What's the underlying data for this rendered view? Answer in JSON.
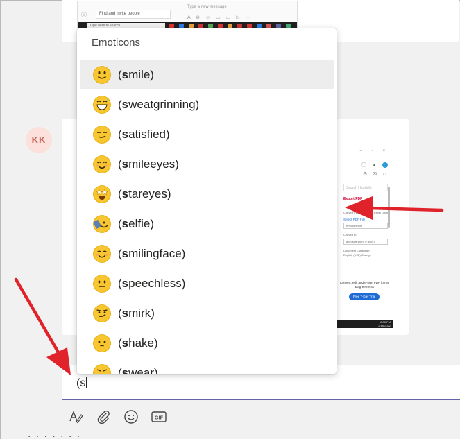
{
  "background": {
    "top_screenshot": {
      "find_people": "Find and invite people",
      "type_new_message": "Type a new message",
      "taskbar_search": "Type here to search"
    },
    "avatar_initials": "KK",
    "right_screenshot": {
      "search_placeholder": "Search Highlight",
      "export_pdf": "Export PDF",
      "convert_text": "Convert PDF to Word or Excel Online",
      "select_pdf_file": "Select PDF File",
      "file_name": "mmouddy.pdf",
      "convert_to": "Convert to",
      "convert_to_value": "Microsoft Word (*.docx)",
      "doc_language": "Document Language:",
      "language_value": "English (U.S.) Change",
      "promo_text": "Convert, edit and e-sign PDF forms & agreements",
      "promo_button": "Free 7-Day Trial",
      "clock_time": "8:38 PM",
      "clock_date": "2/16/2022"
    },
    "partial_text": "I"
  },
  "popup": {
    "title": "Emoticons",
    "items": [
      {
        "prefix": "(",
        "match": "s",
        "rest": "mile)",
        "icon": "smile-emoji-icon",
        "selected": true
      },
      {
        "prefix": "(",
        "match": "s",
        "rest": "weatgrinning)",
        "icon": "sweatgrinning-emoji-icon",
        "selected": false
      },
      {
        "prefix": "(",
        "match": "s",
        "rest": "atisfied)",
        "icon": "satisfied-emoji-icon",
        "selected": false
      },
      {
        "prefix": "(",
        "match": "s",
        "rest": "mileeyes)",
        "icon": "smileeyes-emoji-icon",
        "selected": false
      },
      {
        "prefix": "(",
        "match": "s",
        "rest": "tareyes)",
        "icon": "stareyes-emoji-icon",
        "selected": false
      },
      {
        "prefix": "(",
        "match": "s",
        "rest": "elfie)",
        "icon": "selfie-emoji-icon",
        "selected": false
      },
      {
        "prefix": "(",
        "match": "s",
        "rest": "milingface)",
        "icon": "smilingface-emoji-icon",
        "selected": false
      },
      {
        "prefix": "(",
        "match": "s",
        "rest": "peechless)",
        "icon": "speechless-emoji-icon",
        "selected": false
      },
      {
        "prefix": "(",
        "match": "s",
        "rest": "mirk)",
        "icon": "smirk-emoji-icon",
        "selected": false
      },
      {
        "prefix": "(",
        "match": "s",
        "rest": "hake)",
        "icon": "shake-emoji-icon",
        "selected": false
      },
      {
        "prefix": "(",
        "match": "s",
        "rest": "wear)",
        "icon": "swear-emoji-icon",
        "selected": false
      }
    ]
  },
  "compose": {
    "value": "(s"
  },
  "toolbar": {
    "icons": [
      "format-icon",
      "attach-icon",
      "emoji-icon",
      "gif-icon"
    ],
    "gif_label": "GIF"
  },
  "colors": {
    "accent": "#6264a7",
    "arrow": "#e0232b",
    "emoji_yellow": "#f7c631",
    "selected_bg": "#ededed"
  }
}
